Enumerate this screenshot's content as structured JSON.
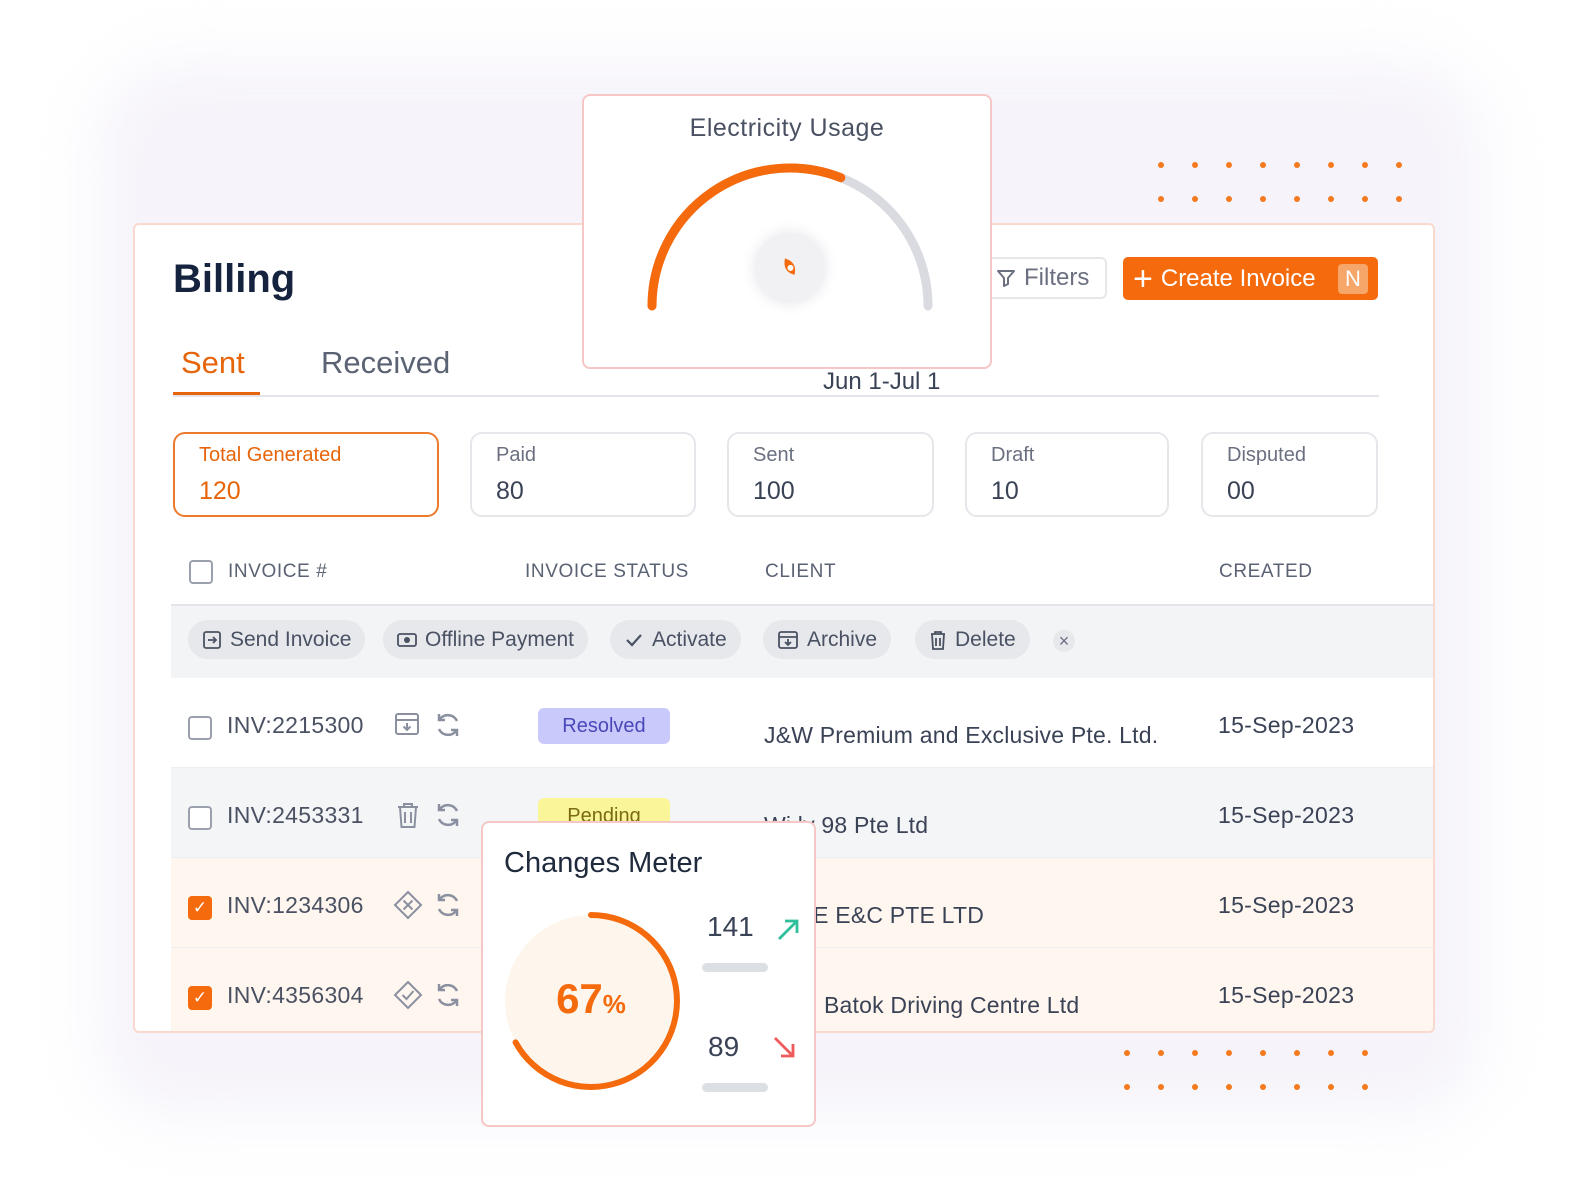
{
  "billing": {
    "title": "Billing",
    "tabs": [
      "Sent",
      "Received"
    ],
    "date_range": "Jun 1-Jul 1",
    "filters_label": "Filters",
    "create_label": "Create Invoice",
    "create_shortcut": "N"
  },
  "stats": [
    {
      "label": "Total Generated",
      "value": "120"
    },
    {
      "label": "Paid",
      "value": "80"
    },
    {
      "label": "Sent",
      "value": "100"
    },
    {
      "label": "Draft",
      "value": "10"
    },
    {
      "label": "Disputed",
      "value": "00"
    }
  ],
  "table": {
    "headers": [
      "INVOICE #",
      "INVOICE STATUS",
      "CLIENT",
      "CREATED"
    ],
    "actions": [
      "Send Invoice",
      "Offline Payment",
      "Activate",
      "Archive",
      "Delete"
    ],
    "rows": [
      {
        "invoice": "INV:2215300",
        "status": "Resolved",
        "client": "J&W Premium and Exclusive Pte. Ltd.",
        "created": "15-Sep-2023",
        "checked": false
      },
      {
        "invoice": "INV:2453331",
        "status": "Pending",
        "client": "Wi  ly 98 Pte Ltd",
        "created": "15-Sep-2023",
        "checked": false
      },
      {
        "invoice": "INV:1234306",
        "status": "",
        "client": "ZONE E&C PTE LTD",
        "created": "15-Sep-2023",
        "checked": true
      },
      {
        "invoice": "INV:4356304",
        "status": "",
        "client": "Batok Driving Centre Ltd",
        "created": "15-Sep-2023",
        "checked": true
      }
    ]
  },
  "electricity": {
    "title": "Electricity Usage",
    "level": 0.62
  },
  "changes_meter": {
    "title": "Changes Meter",
    "percent_value": "67",
    "percent_sign": "%",
    "percent": 67,
    "up_value": "141",
    "down_value": "89"
  },
  "colors": {
    "accent": "#f46a0c",
    "resolved_bg": "#c9c9fb",
    "pending_bg": "#fbf59a",
    "up_arrow": "#2fbf9a",
    "down_arrow": "#ef5a5a"
  },
  "icons": [
    "filter-icon",
    "plus-icon",
    "send-invoice-icon",
    "offline-payment-icon",
    "check-icon",
    "archive-icon",
    "trash-icon",
    "close-icon",
    "refresh-icon",
    "diamond-cross-icon",
    "diamond-check-icon",
    "arrow-up-right-icon",
    "arrow-down-right-icon"
  ]
}
